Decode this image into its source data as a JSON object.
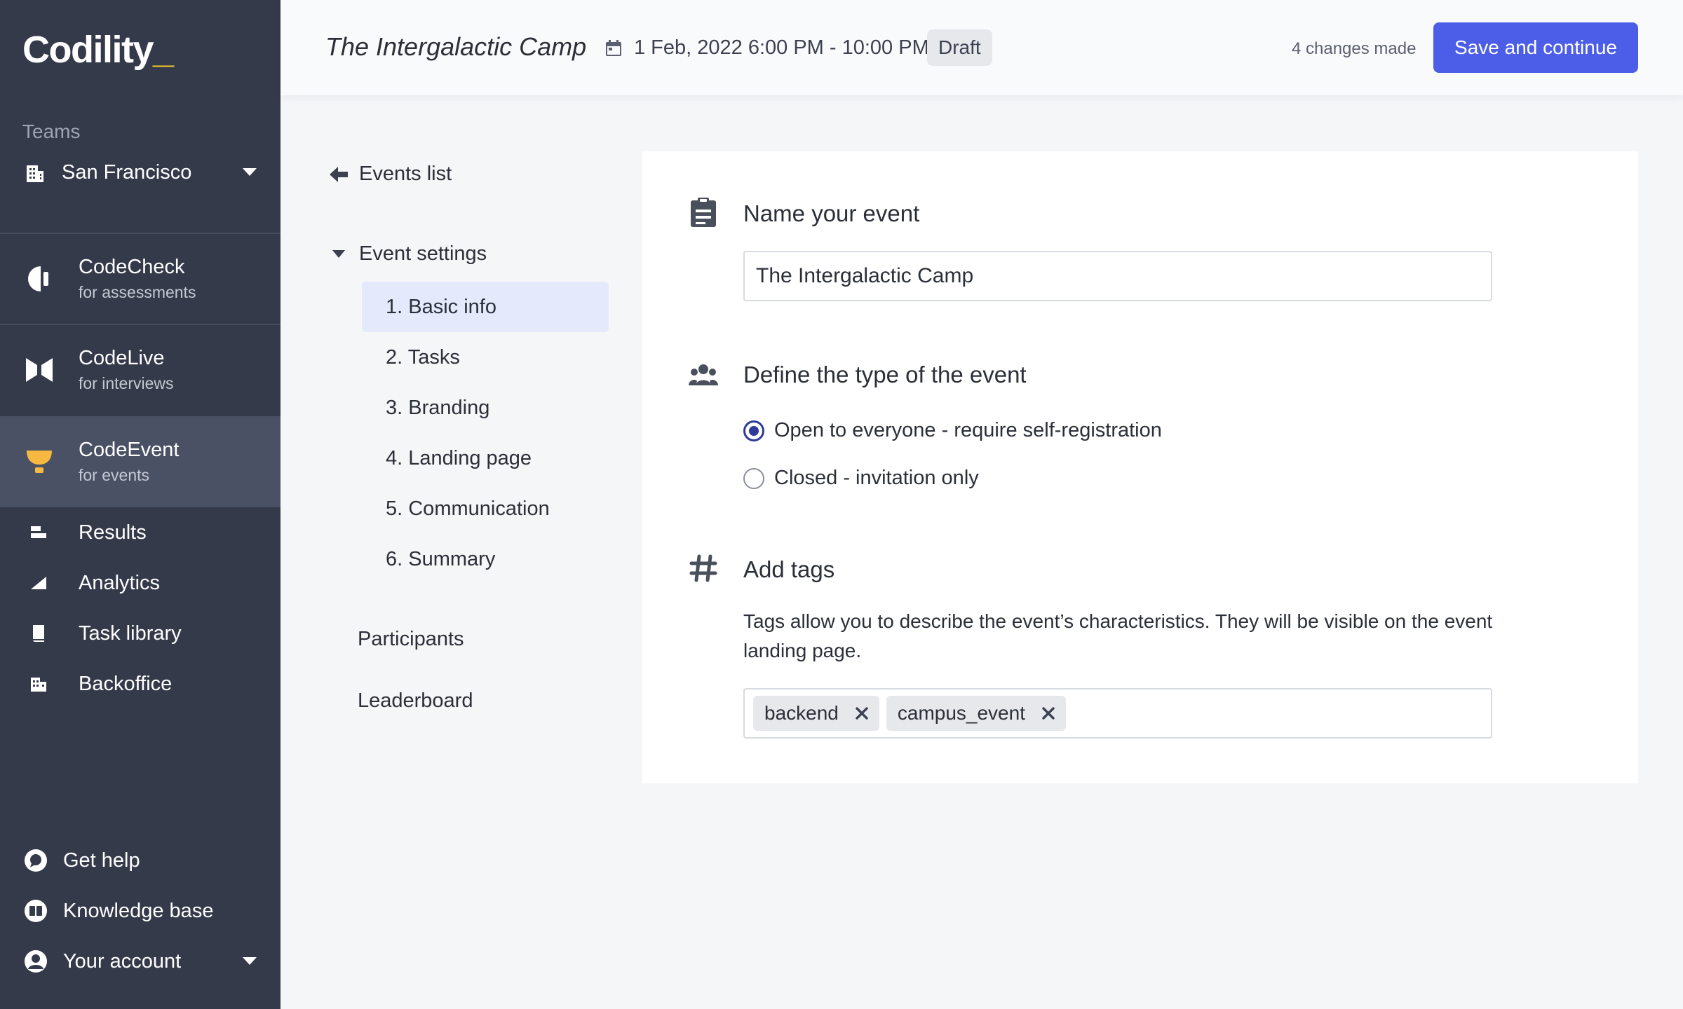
{
  "brand": {
    "logo_text": "Codility",
    "logo_accent": "_",
    "accent_color": "#f5d12a"
  },
  "sidebar": {
    "teams_label": "Teams",
    "team": "San Francisco",
    "products": [
      {
        "title": "CodeCheck",
        "subtitle": "for assessments",
        "icon": "codecheck-icon"
      },
      {
        "title": "CodeLive",
        "subtitle": "for interviews",
        "icon": "codelive-icon"
      },
      {
        "title": "CodeEvent",
        "subtitle": "for events",
        "icon": "trophy-icon",
        "active": true
      }
    ],
    "nav": [
      {
        "label": "Results",
        "icon": "results-icon"
      },
      {
        "label": "Analytics",
        "icon": "analytics-icon"
      },
      {
        "label": "Task library",
        "icon": "task-library-icon"
      },
      {
        "label": "Backoffice",
        "icon": "backoffice-icon"
      }
    ],
    "bottom": [
      {
        "label": "Get help",
        "icon": "chat-icon"
      },
      {
        "label": "Knowledge base",
        "icon": "book-icon"
      },
      {
        "label": "Your account",
        "icon": "user-icon"
      }
    ]
  },
  "header": {
    "event_title": "The Intergalactic Camp",
    "date_range": "1 Feb, 2022 6:00 PM - 10:00 PM",
    "status": "Draft",
    "changes": "4 changes made",
    "save_label": "Save and continue",
    "primary_color": "#4c5ee8"
  },
  "secondary_nav": {
    "back_label": "Events list",
    "settings_label": "Event settings",
    "steps": [
      {
        "label": "1. Basic info",
        "active": true
      },
      {
        "label": "2. Tasks"
      },
      {
        "label": "3. Branding"
      },
      {
        "label": "4. Landing page"
      },
      {
        "label": "5. Communication"
      },
      {
        "label": "6. Summary"
      }
    ],
    "participants_label": "Participants",
    "leaderboard_label": "Leaderboard"
  },
  "form": {
    "name_section": {
      "title": "Name your event",
      "value": "The Intergalactic Camp"
    },
    "type_section": {
      "title": "Define the type of the event",
      "options": [
        {
          "label": "Open to everyone - require self-registration",
          "checked": true
        },
        {
          "label": "Closed - invitation only",
          "checked": false
        }
      ]
    },
    "tags_section": {
      "title": "Add tags",
      "description": "Tags allow you to describe the event’s characteristics. They will be visible on the event landing page.",
      "tags": [
        "backend",
        "campus_event"
      ]
    }
  }
}
